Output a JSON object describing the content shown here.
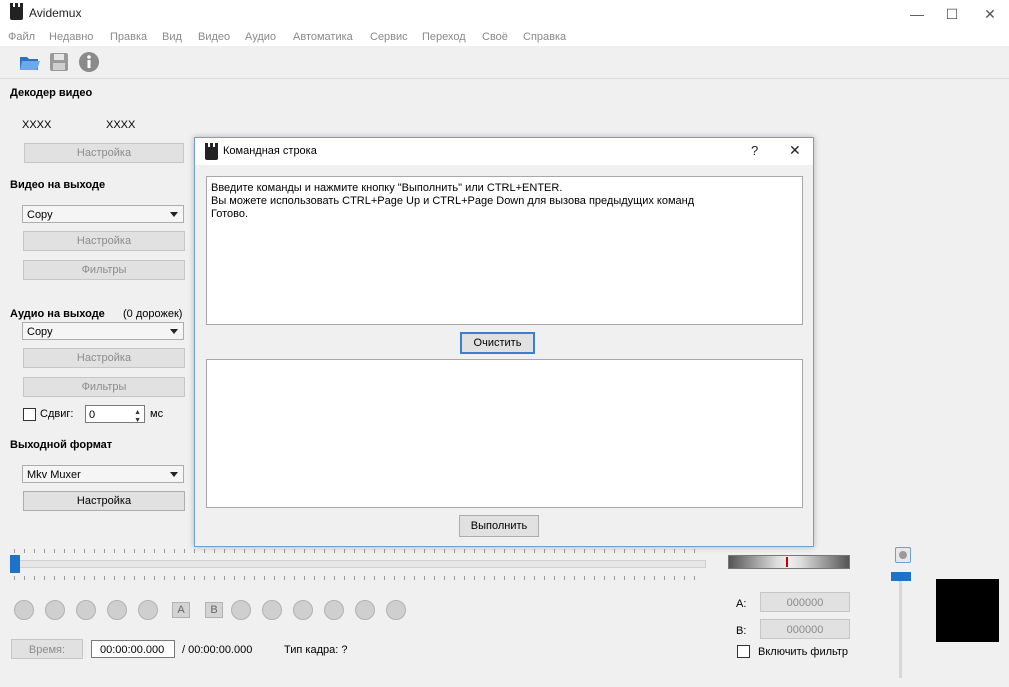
{
  "window": {
    "title": "Avidemux",
    "minimize": "—",
    "maximize": "☐",
    "close": "✕"
  },
  "menu": [
    "Файл",
    "Недавно",
    "Правка",
    "Вид",
    "Видео",
    "Аудио",
    "Автоматика",
    "Сервис",
    "Переход",
    "Своё",
    "Справка"
  ],
  "toolbar": {
    "icons": [
      "open-folder-icon",
      "save-icon",
      "info-icon"
    ]
  },
  "left": {
    "video_decoder": {
      "title": "Декодер видео",
      "codec_a": "XXXX",
      "codec_b": "XXXX",
      "settings": "Настройка"
    },
    "video_output": {
      "title": "Видео на выходе",
      "codec": "Copy",
      "settings": "Настройка",
      "filters": "Фильтры"
    },
    "audio_output": {
      "title": "Аудио на выходе",
      "tracks": "(0 дорожек)",
      "codec": "Copy",
      "settings": "Настройка",
      "filters": "Фильтры",
      "shift_label": "Сдвиг:",
      "shift_value": "0",
      "shift_unit": "мс"
    },
    "output_format": {
      "title": "Выходной формат",
      "muxer": "Mkv Muxer",
      "settings": "Настройка"
    }
  },
  "dialog": {
    "title": "Командная строка",
    "help": "?",
    "close": "✕",
    "log": [
      "Введите команды и нажмите кнопку \"Выполнить\" или CTRL+ENTER.",
      "Вы можете использовать CTRL+Page Up и CTRL+Page Down для вызова предыдущих команд",
      "Готово."
    ],
    "clear": "Очистить",
    "input_value": "",
    "run": "Выполнить"
  },
  "bottom": {
    "time_label": "Время:",
    "current_time": "00:00:00.000",
    "total_time": "/ 00:00:00.000",
    "frame_type": "Тип кадра:  ?",
    "marker_a_label": "A:",
    "marker_a": "000000",
    "marker_b_label": "B:",
    "marker_b": "000000",
    "enable_filter": "Включить фильтр",
    "ab_a": "A",
    "ab_b": "B"
  },
  "colors": {
    "dialog_border": "#6aa0d8",
    "slider_handle": "#1e73c8"
  }
}
